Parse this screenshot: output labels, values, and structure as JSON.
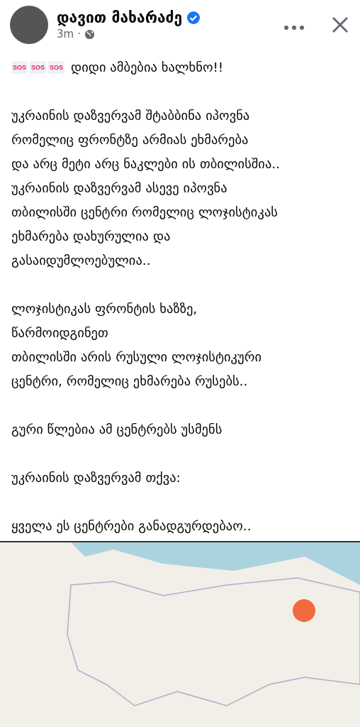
{
  "post": {
    "author": "დავით მახარაძე",
    "verified": true,
    "time": "3m",
    "separator": "·",
    "badges": [
      "SOS",
      "SOS",
      "SOS"
    ],
    "headline": "დიდი ამბებია ხალხნო!!",
    "paragraphs": [
      [
        "უკრაინის დაზვერვამ შტაბბინა იპოვნა",
        "რომელიც ფრონტზე არმიას ეხმარება",
        "და არც მეტი არც ნაკლები ის თბილისშია..",
        "უკრაინის დაზვერვამ ასევე იპოვნა",
        "თბილისში ცენტრი რომელიც ლოჯისტიკას",
        "ეხმარება დახურულია და",
        "გასაიდუმლოებულია.."
      ],
      [
        "ლოჯისტიკას ფრონტის ხაზზე,",
        "წარმოიდგინეთ",
        "თბილისში არის რუსული ლოჯისტიკური",
        "ცენტრი, რომელიც ეხმარება რუსებს.."
      ],
      [
        "გური წლებია ამ ცენტრებს უსმენს"
      ],
      [
        "უკრაინის დაზვერვამ თქვა:"
      ],
      [
        "ყველა ეს ცენტრები განადგურდებაო.."
      ]
    ]
  }
}
